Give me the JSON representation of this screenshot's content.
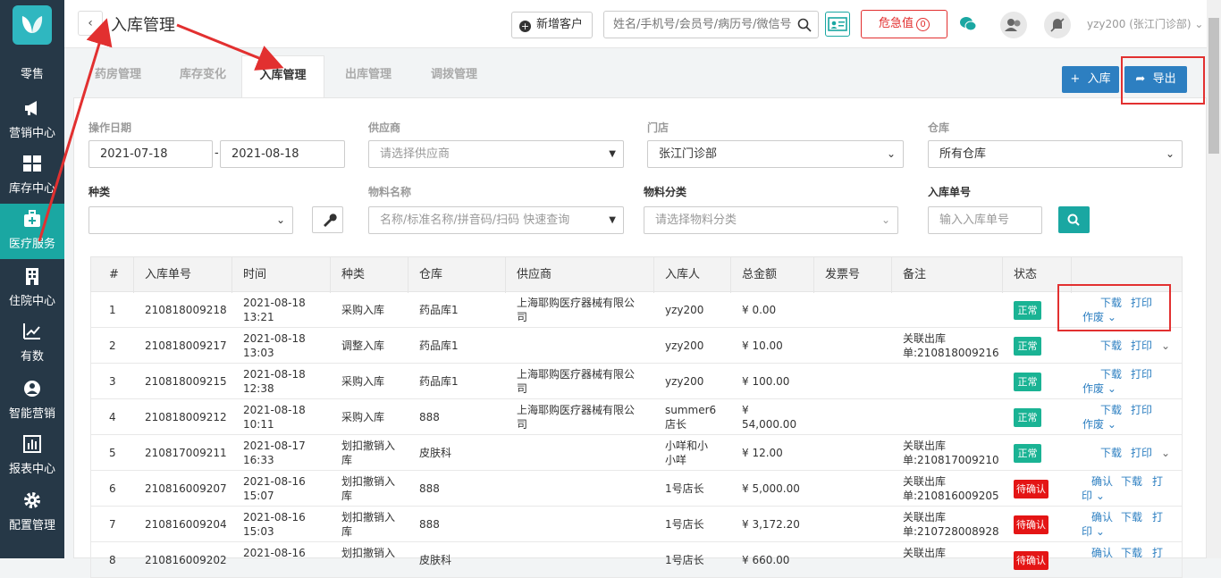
{
  "sidebar": {
    "items": [
      {
        "label": "零售",
        "icon": "retail-icon"
      },
      {
        "label": "营销中心",
        "icon": "megaphone-icon"
      },
      {
        "label": "库存中心",
        "icon": "grid-icon"
      },
      {
        "label": "医疗服务",
        "icon": "medical-kit-icon"
      },
      {
        "label": "住院中心",
        "icon": "building-icon"
      },
      {
        "label": "有数",
        "icon": "trend-chart-icon"
      },
      {
        "label": "智能营销",
        "icon": "smart-marketing-icon"
      },
      {
        "label": "报表中心",
        "icon": "bar-chart-icon"
      },
      {
        "label": "配置管理",
        "icon": "gear-icon"
      }
    ]
  },
  "header": {
    "back": "‹",
    "title": "入库管理",
    "new_customer": "新增客户",
    "search_placeholder": "姓名/手机号/会员号/病历号/微信号",
    "danger": "危急值",
    "danger_count": "0",
    "user": "yzy200 (张江门诊部)"
  },
  "tabs": [
    "药房管理",
    "库存变化",
    "入库管理",
    "出库管理",
    "调拨管理"
  ],
  "actions": {
    "in_stock": "入库",
    "export": "导出"
  },
  "filters": {
    "op_date_label": "操作日期",
    "date_from": "2021-07-18",
    "date_sep": "-",
    "date_to": "2021-08-18",
    "supplier_label": "供应商",
    "supplier_placeholder": "请选择供应商",
    "store_label": "门店",
    "store_value": "张江门诊部",
    "warehouse_label": "仓库",
    "warehouse_value": "所有仓库",
    "type_label": "种类",
    "material_name_label": "物料名称",
    "material_name_placeholder": "名称/标准名称/拼音码/扫码 快速查询",
    "material_cat_label": "物料分类",
    "material_cat_placeholder": "请选择物料分类",
    "order_no_label": "入库单号",
    "order_no_placeholder": "输入入库单号"
  },
  "table": {
    "headers": [
      "#",
      "入库单号",
      "时间",
      "种类",
      "仓库",
      "供应商",
      "入库人",
      "总金额",
      "发票号",
      "备注",
      "状态",
      ""
    ],
    "rows": [
      {
        "idx": "1",
        "no": "210818009218",
        "date": "2021-08-18",
        "time": "13:21",
        "type": "采购入库",
        "wh": "药品库1",
        "sup1": "上海耶购医疗器械有限公",
        "sup2": "司",
        "person": "yzy200",
        "amt": "¥ 0.00",
        "note1": "",
        "note2": "",
        "status": "正常",
        "act1": "下载",
        "act2": "打印",
        "act3": "作废"
      },
      {
        "idx": "2",
        "no": "210818009217",
        "date": "2021-08-18",
        "time": "13:03",
        "type": "调整入库",
        "wh": "药品库1",
        "sup1": "",
        "sup2": "",
        "person": "yzy200",
        "amt": "¥ 10.00",
        "note1": "关联出库",
        "note2": "单:210818009216",
        "status": "正常",
        "act1": "下载",
        "act2": "打印",
        "act3": ""
      },
      {
        "idx": "3",
        "no": "210818009215",
        "date": "2021-08-18",
        "time": "12:38",
        "type": "采购入库",
        "wh": "药品库1",
        "sup1": "上海耶购医疗器械有限公",
        "sup2": "司",
        "person": "yzy200",
        "amt": "¥ 100.00",
        "note1": "",
        "note2": "",
        "status": "正常",
        "act1": "下载",
        "act2": "打印",
        "act3": "作废"
      },
      {
        "idx": "4",
        "no": "210818009212",
        "date": "2021-08-18",
        "time": "10:11",
        "type": "采购入库",
        "wh": "888",
        "sup1": "上海耶购医疗器械有限公",
        "sup2": "司",
        "person": "summer6",
        "person2": "店长",
        "amt": "¥",
        "amt2": "54,000.00",
        "note1": "",
        "note2": "",
        "status": "正常",
        "act1": "下载",
        "act2": "打印",
        "act3": "作废"
      },
      {
        "idx": "5",
        "no": "210817009211",
        "date": "2021-08-17",
        "time": "16:33",
        "type": "划扣撤销入",
        "type2": "库",
        "wh": "皮肤科",
        "sup1": "",
        "sup2": "",
        "person": "小咩和小",
        "person2": "小咩",
        "amt": "¥ 12.00",
        "note1": "关联出库",
        "note2": "单:210817009210",
        "status": "正常",
        "act1": "下载",
        "act2": "打印",
        "act3": ""
      },
      {
        "idx": "6",
        "no": "210816009207",
        "date": "2021-08-16",
        "time": "15:07",
        "type": "划扣撤销入",
        "type2": "库",
        "wh": "888",
        "sup1": "",
        "sup2": "",
        "person": "1号店长",
        "amt": "¥ 5,000.00",
        "note1": "关联出库",
        "note2": "单:210816009205",
        "status": "待确认",
        "act0": "确认",
        "act1": "下载",
        "act2": "打",
        "act3": "印"
      },
      {
        "idx": "7",
        "no": "210816009204",
        "date": "2021-08-16",
        "time": "15:03",
        "type": "划扣撤销入",
        "type2": "库",
        "wh": "888",
        "sup1": "",
        "sup2": "",
        "person": "1号店长",
        "amt": "¥ 3,172.20",
        "note1": "关联出库",
        "note2": "单:210728008928",
        "status": "待确认",
        "act0": "确认",
        "act1": "下载",
        "act2": "打",
        "act3": "印"
      },
      {
        "idx": "8",
        "no": "210816009202",
        "date": "2021-08-16",
        "time": "",
        "type": "划扣撤销入",
        "type2": "",
        "wh": "皮肤科",
        "sup1": "",
        "sup2": "",
        "person": "1号店长",
        "amt": "¥ 660.00",
        "note1": "关联出库",
        "note2": "",
        "status": "待确认",
        "act0": "确认",
        "act1": "下载",
        "act2": "打",
        "act3": ""
      }
    ]
  },
  "colors": {
    "sidebar": "#263847",
    "accent": "#1aa7a2",
    "primary": "#2d7fc1",
    "danger": "#e23030",
    "ok": "#1ab394"
  }
}
